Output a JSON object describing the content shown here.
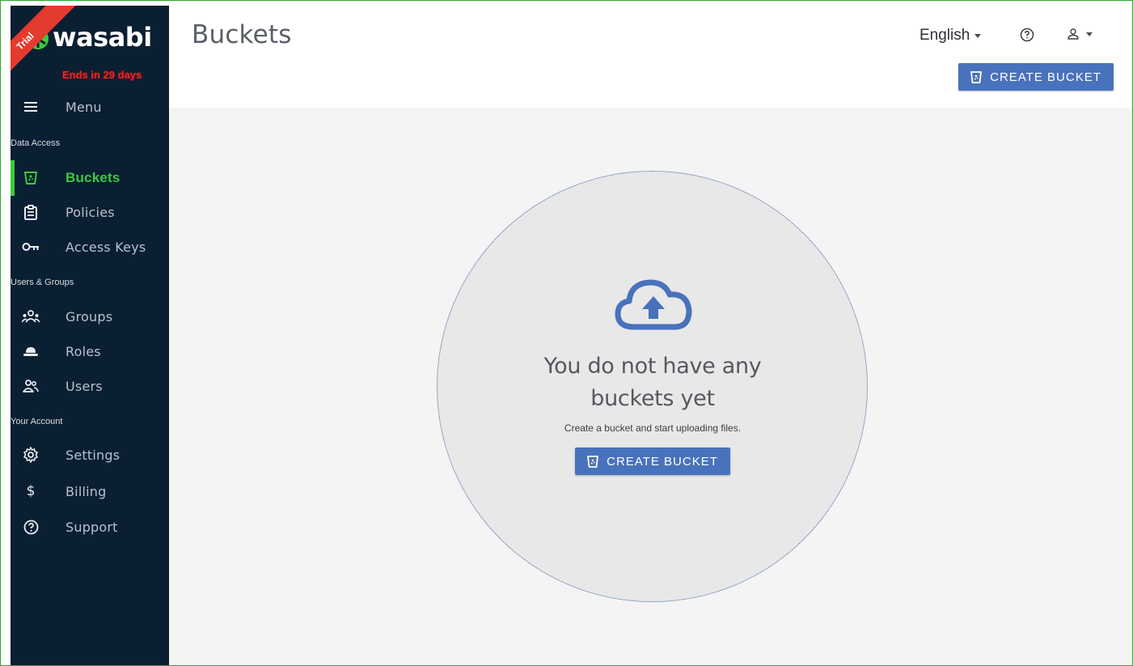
{
  "brand": {
    "trial_ribbon": "Trial",
    "logo_text": "wasabi",
    "trial_notice": "Ends in 29 days"
  },
  "sidebar": {
    "menu_label": "Menu",
    "sections": [
      {
        "title": "Data Access",
        "items": [
          {
            "label": "Buckets",
            "icon": "bucket-icon",
            "active": true
          },
          {
            "label": "Policies",
            "icon": "clipboard-icon",
            "active": false
          },
          {
            "label": "Access Keys",
            "icon": "key-icon",
            "active": false
          }
        ]
      },
      {
        "title": "Users & Groups",
        "items": [
          {
            "label": "Groups",
            "icon": "groups-icon",
            "active": false
          },
          {
            "label": "Roles",
            "icon": "hat-icon",
            "active": false
          },
          {
            "label": "Users",
            "icon": "users-icon",
            "active": false
          }
        ]
      },
      {
        "title": "Your Account",
        "items": [
          {
            "label": "Settings",
            "icon": "gear-icon",
            "active": false
          },
          {
            "label": "Billing",
            "icon": "dollar-icon",
            "active": false
          },
          {
            "label": "Support",
            "icon": "help-circle-icon",
            "active": false
          }
        ]
      }
    ]
  },
  "header": {
    "title": "Buckets",
    "language": "English",
    "create_bucket_label": "CREATE BUCKET"
  },
  "empty_state": {
    "title_line1": "You do not have any",
    "title_line2": "buckets yet",
    "subtitle": "Create a bucket and start uploading files.",
    "button_label": "CREATE BUCKET"
  },
  "colors": {
    "sidebar_bg": "#0b1f33",
    "accent_green": "#3ec93e",
    "primary_blue": "#4872bb",
    "trial_red": "#e53a2e"
  }
}
